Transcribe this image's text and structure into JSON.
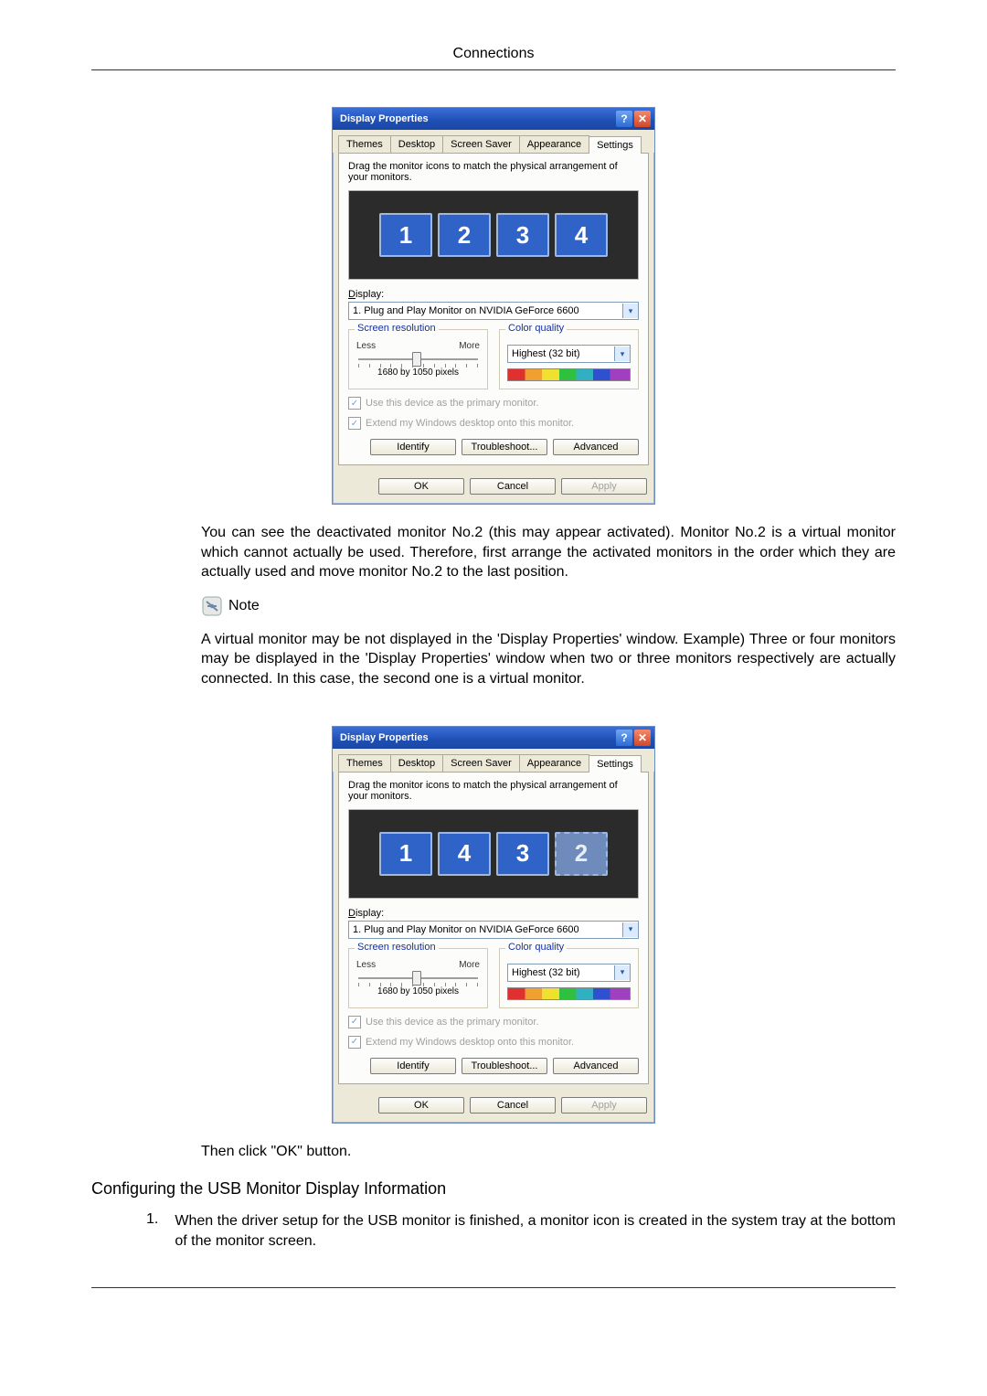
{
  "header": {
    "title": "Connections"
  },
  "dialog": {
    "title": "Display Properties",
    "help": "?",
    "close": "✕",
    "tabs": [
      "Themes",
      "Desktop",
      "Screen Saver",
      "Appearance",
      "Settings"
    ],
    "active_tab": "Settings",
    "drag_hint": "Drag the monitor icons to match the physical arrangement of your monitors.",
    "display_label": "Display:",
    "display_value": "1. Plug and Play Monitor on NVIDIA GeForce 6600",
    "screen_res": {
      "title": "Screen resolution",
      "less": "Less",
      "more": "More",
      "value": "1680 by 1050 pixels"
    },
    "color": {
      "title": "Color quality",
      "value": "Highest (32 bit)"
    },
    "check_primary": "Use this device as the primary monitor.",
    "check_extend": "Extend my Windows desktop onto this monitor.",
    "identify": "Identify",
    "troubleshoot": "Troubleshoot...",
    "advanced": "Advanced",
    "ok": "OK",
    "cancel": "Cancel",
    "apply": "Apply"
  },
  "monitors1": [
    {
      "n": "1",
      "state": "active"
    },
    {
      "n": "2",
      "state": "active"
    },
    {
      "n": "3",
      "state": "active"
    },
    {
      "n": "4",
      "state": "active"
    }
  ],
  "monitors2": [
    {
      "n": "1",
      "state": "active"
    },
    {
      "n": "4",
      "state": "active"
    },
    {
      "n": "3",
      "state": "active"
    },
    {
      "n": "2",
      "state": "dim"
    }
  ],
  "text": {
    "para1": "You can see the deactivated monitor No.2 (this may appear activated). Monitor No.2 is a virtual monitor which cannot actually be used. Therefore, first arrange the activated monitors in the order which they are actually used and move monitor No.2 to the last position.",
    "note": "Note",
    "para2": "A virtual monitor may be not displayed in the 'Display Properties' window. Example) Three or four monitors may be displayed in the 'Display Properties' window when two or three monitors respectively are actually connected. In this case, the second one is a virtual monitor.",
    "para3": "Then click \"OK\" button.",
    "section": "Configuring the USB Monitor Display Information",
    "list1_num": "1.",
    "list1": "When the driver setup for the USB monitor is finished, a monitor icon is created in the system tray at the bottom of the monitor screen."
  }
}
